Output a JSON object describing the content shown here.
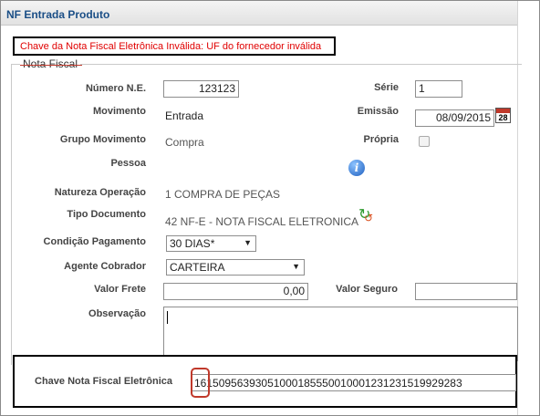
{
  "window": {
    "title": "NF Entrada Produto"
  },
  "error_message": "Chave da Nota Fiscal Eletrônica Inválida: UF do fornecedor inválida",
  "section_legend": "Nota Fiscal",
  "fields": {
    "numero_ne": {
      "label": "Número N.E.",
      "value": "123123"
    },
    "serie": {
      "label": "Série",
      "value": "1"
    },
    "movimento": {
      "label": "Movimento",
      "value": "Entrada"
    },
    "emissao": {
      "label": "Emissão",
      "value": "08/09/2015"
    },
    "grupo_movimento": {
      "label": "Grupo Movimento",
      "value": "Compra"
    },
    "propria": {
      "label": "Própria",
      "checked": false
    },
    "pessoa": {
      "label": "Pessoa",
      "value": ""
    },
    "natureza_operacao": {
      "label": "Natureza Operação",
      "value": "1 COMPRA DE PEÇAS"
    },
    "tipo_documento": {
      "label": "Tipo Documento",
      "value": "42 NF-E - NOTA FISCAL ELETRONICA"
    },
    "condicao_pagamento": {
      "label": "Condição Pagamento",
      "value": "30 DIAS*"
    },
    "agente_cobrador": {
      "label": "Agente Cobrador",
      "value": "CARTEIRA"
    },
    "valor_frete": {
      "label": "Valor Frete",
      "value": "0,00"
    },
    "valor_seguro": {
      "label": "Valor Seguro",
      "value": ""
    },
    "observacao": {
      "label": "Observação",
      "value": ""
    },
    "chave_nfe": {
      "label": "Chave Nota Fiscal Eletrônica",
      "value": "16150956393051000185550010001231231519929283"
    }
  },
  "calendar_day": "28",
  "info_icon_glyph": "i",
  "colors": {
    "title": "#1a4e86",
    "error": "#e00000",
    "highlight": "#c0392b"
  },
  "icons": [
    "calendar-icon",
    "info-icon",
    "refresh-icon",
    "dropdown-arrow-icon"
  ]
}
